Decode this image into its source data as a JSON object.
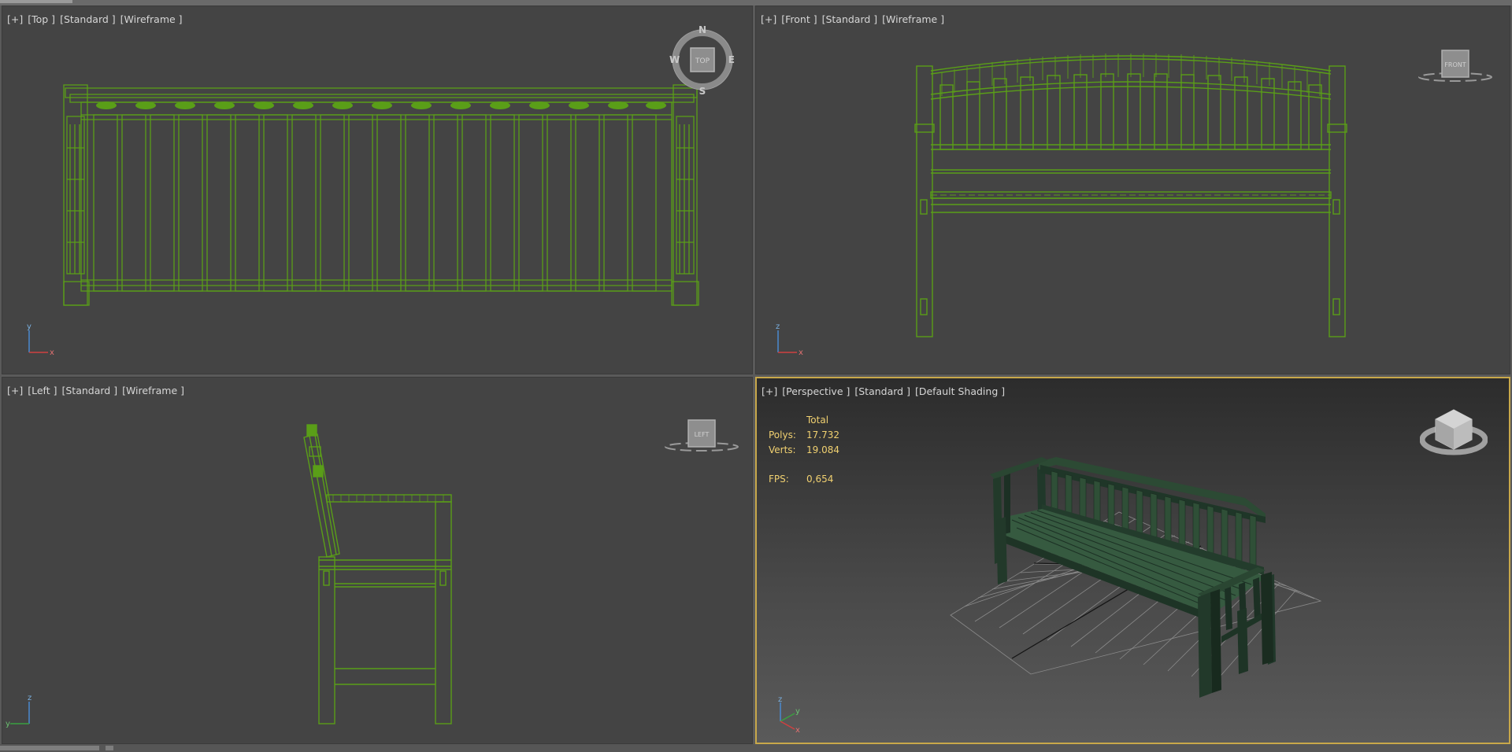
{
  "viewports": {
    "top": {
      "labels": [
        "[+]",
        "[Top ]",
        "[Standard ]",
        "[Wireframe ]"
      ],
      "compass": {
        "n": "N",
        "s": "S",
        "e": "E",
        "w": "W",
        "face": "TOP"
      },
      "axes": {
        "up": "y",
        "right": "x"
      }
    },
    "front": {
      "labels": [
        "[+]",
        "[Front ]",
        "[Standard ]",
        "[Wireframe ]"
      ],
      "cube_face": "FRONT",
      "axes": {
        "up": "z",
        "right": "x"
      }
    },
    "left": {
      "labels": [
        "[+]",
        "[Left ]",
        "[Standard ]",
        "[Wireframe ]"
      ],
      "cube_face": "LEFT",
      "axes": {
        "up": "z",
        "right": "y"
      }
    },
    "perspective": {
      "labels": [
        "[+]",
        "[Perspective ]",
        "[Standard ]",
        "[Default Shading ]"
      ],
      "stats": {
        "header": "Total",
        "polys_label": "Polys:",
        "polys": "17.732",
        "verts_label": "Verts:",
        "verts": "19.084",
        "fps_label": "FPS:",
        "fps": "0,654"
      },
      "axes": {
        "up": "z",
        "right": "y",
        "depth": "x"
      }
    }
  },
  "colors": {
    "wire": "#5a9e18",
    "viewport_bg": "#444444",
    "active_border": "#c8a84a",
    "stats_text": "#f0d070",
    "bench_shaded": "#2c4a32"
  },
  "icons": {
    "compass": "viewcube-compass-icon",
    "cube": "viewcube-icon",
    "axis": "axis-tripod-icon"
  }
}
